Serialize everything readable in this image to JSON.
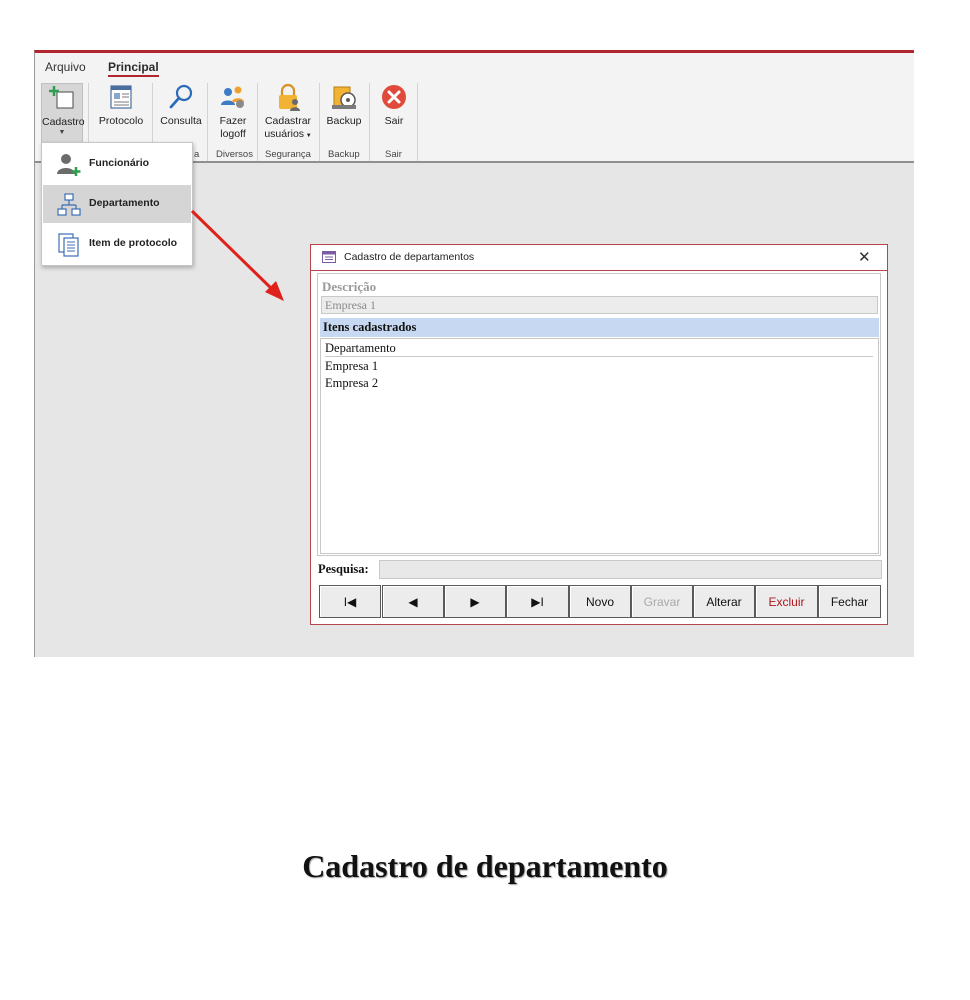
{
  "ribbon": {
    "tabs": [
      "Arquivo",
      "Principal"
    ],
    "active_tab": "Principal",
    "buttons": {
      "cadastro": "Cadastro",
      "protocolo": "Protocolo",
      "consulta": "Consulta",
      "fazer_logoff_line1": "Fazer",
      "fazer_logoff_line2": "logoff",
      "cadastrar_usuarios_line1": "Cadastrar",
      "cadastrar_usuarios_line2": "usuários",
      "backup": "Backup",
      "sair": "Sair"
    },
    "groups": {
      "consulta_partial": "a",
      "diversos": "Diversos",
      "seguranca": "Segurança",
      "backup": "Backup",
      "sair": "Sair"
    }
  },
  "dropdown": {
    "items": [
      "Funcionário",
      "Departamento",
      "Item de protocolo"
    ],
    "highlighted": "Departamento"
  },
  "dialog": {
    "title": "Cadastro de departamentos",
    "descricao_label": "Descrição",
    "descricao_value": "Empresa 1",
    "items_header": "Itens cadastrados",
    "list_column": "Departamento",
    "list_rows": [
      "Empresa 1",
      "Empresa 2"
    ],
    "search_label": "Pesquisa:",
    "search_value": "",
    "buttons": {
      "first": "I◀",
      "prev": "◀",
      "next": "▶",
      "last": "▶I",
      "novo": "Novo",
      "gravar": "Gravar",
      "alterar": "Alterar",
      "excluir": "Excluir",
      "fechar": "Fechar"
    }
  },
  "caption": "Cadastro de departamento",
  "colors": {
    "accent": "#b1262e",
    "list_header": "#c7d9f2",
    "danger_text": "#b0171f",
    "arrow": "#e0201a"
  }
}
